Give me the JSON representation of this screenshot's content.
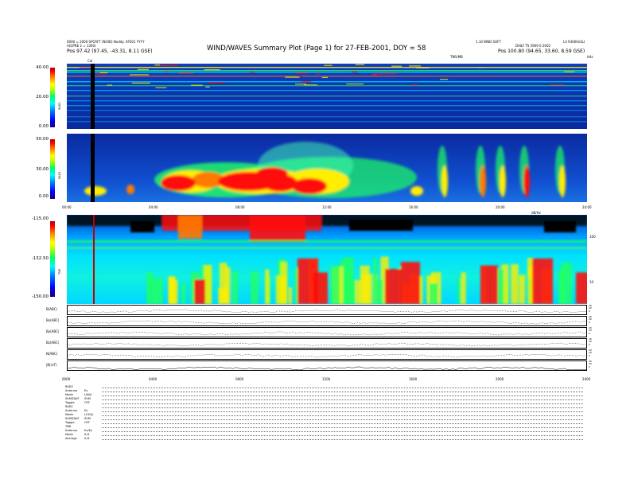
{
  "header": {
    "title": "WIND/WAVES Summary Plot (Page 1) for 27-FEB-2001, DOY = 58",
    "left_line1": "0000 = 2000 SPCRFT (NOID) Noddy: 4FE01 YYYY",
    "left_line2": "A(GPRE 2 = 1300)",
    "left_pos": "Pos   97.42 (97.45, -43.31, 8.11 GSE)",
    "right_line1": "1.10 WND SOFT",
    "right_line2": "DAILY TS 5909 0 2002",
    "right_pos": "Pos   100.80 (94.65, 33.60, 8.59 GSE)",
    "top_right_code": "LS 93000nSLI",
    "top_right_units": "kHz",
    "center_label": "TNR/MB"
  },
  "panels": {
    "rad2": {
      "label": "RAD2",
      "ticks": [
        "40.00",
        "20.00",
        "0.00"
      ]
    },
    "rad1": {
      "label": "RAD1",
      "ticks": [
        "50.00",
        "30.00",
        "0.00"
      ]
    },
    "tnr": {
      "label": "TNR",
      "ticks": [
        "-115.00",
        "-132.50",
        "-150.00"
      ],
      "right_ticks": [
        "100",
        "10"
      ],
      "right_unit": "dB/Hz"
    },
    "cal_label": "Cal"
  },
  "time_axis": {
    "labels": [
      "00:00",
      "04:00",
      "08:00",
      "12:00",
      "16:00",
      "20:00",
      "24:00"
    ]
  },
  "strips": [
    {
      "label": "B(ABC)",
      "ticks": [
        "40",
        "20",
        "0"
      ]
    },
    {
      "label": "Bx(ABC)",
      "ticks": [
        "40",
        "20",
        "0"
      ]
    },
    {
      "label": "By(ABC)",
      "ticks": [
        "40",
        "20",
        "0"
      ]
    },
    {
      "label": "Bz(ABC)",
      "ticks": [
        "40",
        "20",
        "0"
      ]
    },
    {
      "label": "N(ABC)",
      "ticks": [
        "40",
        "20",
        "0"
      ]
    },
    {
      "label": "|B|(nT)",
      "ticks": [
        "40",
        "20",
        "0"
      ]
    }
  ],
  "bottom_axis": {
    "labels": [
      "0000",
      "0400",
      "0800",
      "1200",
      "1600",
      "2000",
      "2400"
    ]
  },
  "metadata": [
    {
      "key": "RAD2",
      "val": ""
    },
    {
      "key": "Antenna",
      "val": "Ex"
    },
    {
      "key": "Mode",
      "val": "LIN(I)"
    },
    {
      "key": "SUM/DAIF",
      "val": "SUM"
    },
    {
      "key": "Toggle",
      "val": "OFF"
    },
    {
      "key": "RAD1",
      "val": ""
    },
    {
      "key": "Antenna",
      "val": "Ex"
    },
    {
      "key": "Mode",
      "val": "LOG(I)"
    },
    {
      "key": "SUM/DAIF",
      "val": "SUM"
    },
    {
      "key": "Toggle",
      "val": "OFF"
    },
    {
      "key": "TNR",
      "val": ""
    },
    {
      "key": "Antenna",
      "val": "Ex/Ey"
    },
    {
      "key": "Mode",
      "val": "A-D"
    },
    {
      "key": "Average",
      "val": "A-D"
    }
  ],
  "chart_data": {
    "type": "heatmap",
    "title": "WIND/WAVES Summary Plot (Page 1) for 27-FEB-2001, DOY = 58",
    "x_range": [
      0,
      24
    ],
    "x_unit": "hours UT",
    "panels": [
      {
        "name": "RAD2",
        "ylim": [
          0,
          40
        ],
        "colors": "intensity"
      },
      {
        "name": "RAD1",
        "ylim": [
          0,
          50
        ],
        "colors": "intensity"
      },
      {
        "name": "TNR",
        "ylim": [
          -150,
          -115
        ],
        "colors": "dB"
      }
    ],
    "colors": {
      "bg": "#0a2aa8",
      "cyan": "#00d8ff",
      "green": "#20ff60",
      "yellow": "#ffee00",
      "orange": "#ff7a00",
      "red": "#ff1010"
    }
  }
}
